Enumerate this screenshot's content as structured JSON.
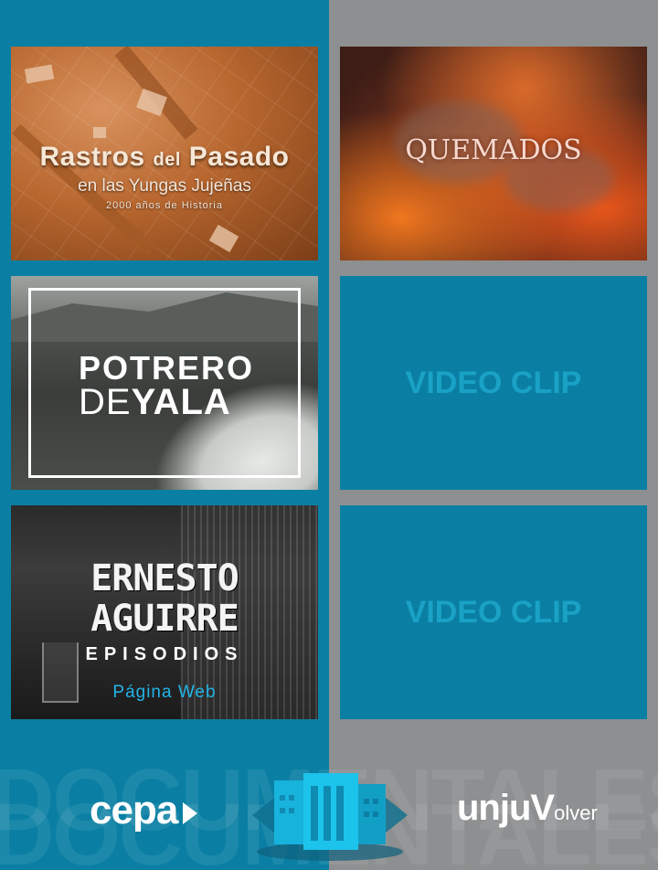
{
  "tiles": {
    "rastros": {
      "title_word1": "Rastros",
      "title_small": "del",
      "title_word2": "Pasado",
      "subtitle": "en las Yungas Jujeñas",
      "tagline": "2000 años de Historia"
    },
    "quemados": {
      "title": "QUEMADOS"
    },
    "potrero": {
      "line1": "POTRERO",
      "line2_thin": "DE",
      "line2_bold": "YALA"
    },
    "ernesto": {
      "line1": "ERNESTO",
      "line2": "AGUIRRE",
      "line3": "EPISODIOS",
      "link": "Página Web"
    },
    "clip1": {
      "label": "VIDEO CLIP"
    },
    "clip2": {
      "label": "VIDEO CLIP"
    }
  },
  "footer": {
    "watermark_top": "DOCUMENTALES",
    "watermark_bottom": "DOCUMENTALES",
    "cepa_logo": "cepa",
    "unju_logo": "unju",
    "unju_suffix": "olver",
    "unju_v": "V"
  },
  "colors": {
    "accent_blue": "#0a7fa3",
    "panel_gray": "#8d8f90",
    "clip_text": "#1aa1c6",
    "link_blue": "#22b4e6"
  },
  "icons": {
    "cepa_arrow": "play-arrow-icon",
    "building": "building-icon"
  }
}
